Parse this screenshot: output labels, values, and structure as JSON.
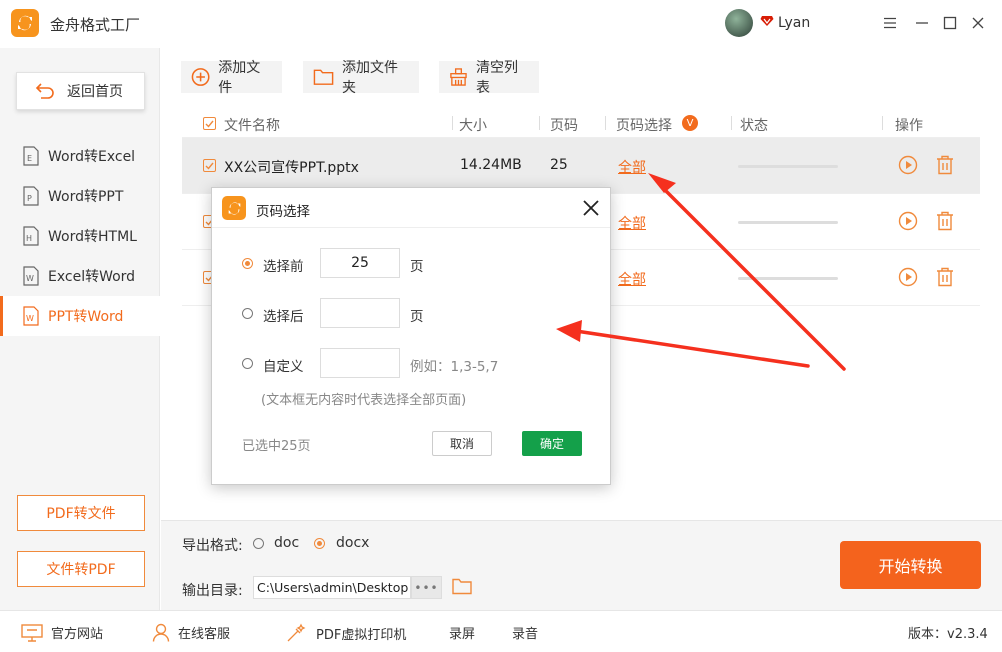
{
  "app": {
    "title": "金舟格式工厂",
    "username": "Lyan",
    "brand_color": "#f26b1d"
  },
  "sidebar": {
    "home": "返回首页",
    "items": [
      {
        "label": "Word转Excel"
      },
      {
        "label": "Word转PPT"
      },
      {
        "label": "Word转HTML"
      },
      {
        "label": "Excel转Word"
      },
      {
        "label": "PPT转Word"
      }
    ],
    "pdf_to_file": "PDF转文件",
    "file_to_pdf": "文件转PDF"
  },
  "toolbar": {
    "add_file": "添加文件",
    "add_folder": "添加文件夹",
    "clear_list": "清空列表"
  },
  "table": {
    "headers": {
      "name": "文件名称",
      "size": "大小",
      "pages": "页码",
      "page_select": "页码选择",
      "status": "状态",
      "actions": "操作"
    },
    "badge": "V",
    "rows": [
      {
        "name": "XX公司宣传PPT.pptx",
        "size": "14.24MB",
        "pages": "25",
        "page_select": "全部"
      },
      {
        "page_select": "全部"
      },
      {
        "page_select": "全部"
      }
    ]
  },
  "export": {
    "format_label": "导出格式:",
    "formats": [
      "doc",
      "docx"
    ],
    "selected_format": "docx",
    "dir_label": "输出目录:",
    "dir_value": "C:\\Users\\admin\\Desktop",
    "dir_more": "•••",
    "start": "开始转换"
  },
  "statusbar": {
    "website": "官方网站",
    "support": "在线客服",
    "printer": "PDF虚拟打印机",
    "screen_record": "录屏",
    "audio_record": "录音",
    "version": "版本：v2.3.4"
  },
  "dialog": {
    "title": "页码选择",
    "option_first": "选择前",
    "option_first_value": "25",
    "option_last": "选择后",
    "option_last_value": "",
    "option_custom": "自定义",
    "custom_value": "",
    "unit": "页",
    "example": "例如：1,3-5,7",
    "hint": "(文本框无内容时代表选择全部页面)",
    "selected_info": "已选中25页",
    "cancel": "取消",
    "ok": "确定"
  }
}
